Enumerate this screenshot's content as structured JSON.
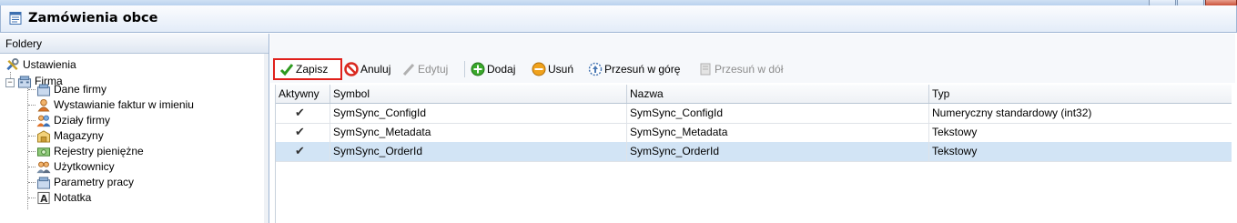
{
  "window": {
    "title": "Zamówienia obce"
  },
  "folders": {
    "header": "Foldery",
    "tree": [
      {
        "label": "Ustawienia",
        "icon": "tools-icon"
      },
      {
        "label": "Firma",
        "icon": "company-icon"
      },
      {
        "label": "Dane firmy",
        "icon": "company-data-icon"
      },
      {
        "label": "Wystawianie faktur w imieniu",
        "icon": "person-icon"
      },
      {
        "label": "Działy firmy",
        "icon": "departments-icon"
      },
      {
        "label": "Magazyny",
        "icon": "warehouse-icon"
      },
      {
        "label": "Rejestry pieniężne",
        "icon": "money-register-icon"
      },
      {
        "label": "Użytkownicy",
        "icon": "users-icon"
      },
      {
        "label": "Parametry pracy",
        "icon": "work-parameters-icon"
      },
      {
        "label": "Notatka",
        "icon": "note-icon"
      }
    ]
  },
  "toolbar": {
    "save": "Zapisz",
    "cancel": "Anuluj",
    "edit": "Edytuj",
    "add": "Dodaj",
    "remove": "Usuń",
    "move_up": "Przesuń w górę",
    "move_down": "Przesuń w dół"
  },
  "grid": {
    "columns": [
      "Aktywny",
      "Symbol",
      "Nazwa",
      "Typ"
    ],
    "rows": [
      {
        "active": true,
        "symbol": "SymSync_ConfigId",
        "name": "SymSync_ConfigId",
        "type": "Numeryczny standardowy (int32)"
      },
      {
        "active": true,
        "symbol": "SymSync_Metadata",
        "name": "SymSync_Metadata",
        "type": "Tekstowy"
      },
      {
        "active": true,
        "symbol": "SymSync_OrderId",
        "name": "SymSync_OrderId",
        "type": "Tekstowy"
      }
    ],
    "selected_row": 2
  },
  "colors": {
    "highlight_border": "#e0201b",
    "selected_row": "#d2e4f5",
    "panel_header": "#dfe7f2"
  }
}
